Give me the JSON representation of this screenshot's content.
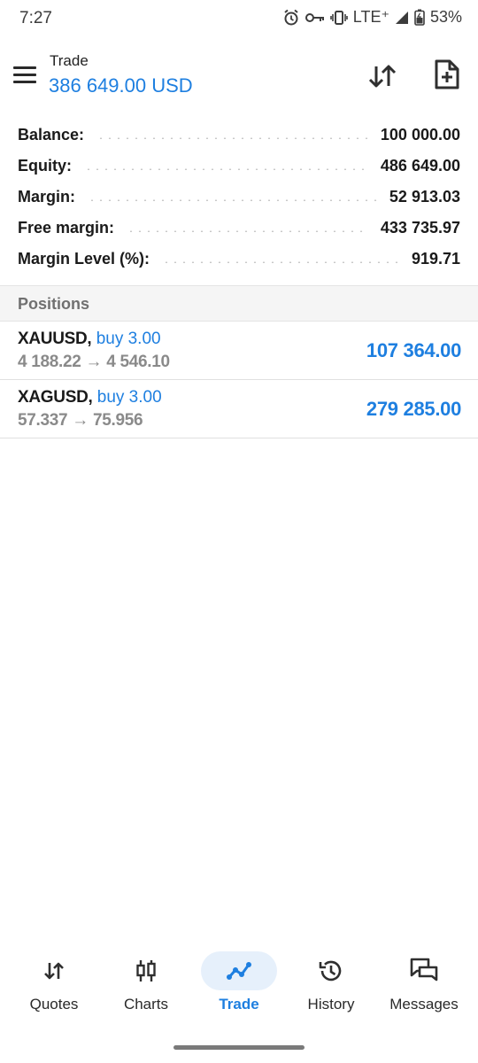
{
  "status_bar": {
    "time": "7:27",
    "network": "LTE⁺",
    "battery": "53%",
    "icons": [
      "alarm-icon",
      "key-icon",
      "vibrate-icon",
      "signal-icon",
      "battery-icon"
    ]
  },
  "header": {
    "title": "Trade",
    "balance": "386 649.00 USD",
    "icons": [
      "menu-icon",
      "sort-arrows-icon",
      "new-order-icon"
    ]
  },
  "summary": [
    {
      "label": "Balance:",
      "value": "100 000.00"
    },
    {
      "label": "Equity:",
      "value": "486 649.00"
    },
    {
      "label": "Margin:",
      "value": "52 913.03"
    },
    {
      "label": "Free margin:",
      "value": "433 735.97"
    },
    {
      "label": "Margin Level (%):",
      "value": "919.71"
    }
  ],
  "positions": {
    "title": "Positions",
    "items": [
      {
        "symbol": "XAUUSD,",
        "type": "buy 3.00",
        "prices": "4 188.22 → 4 546.10",
        "profit": "107 364.00"
      },
      {
        "symbol": "XAGUSD,",
        "type": "buy 3.00",
        "prices": "57.337 → 75.956",
        "profit": "279 285.00"
      }
    ]
  },
  "bottom_nav": [
    {
      "label": "Quotes",
      "icon": "quotes-icon",
      "active": false
    },
    {
      "label": "Charts",
      "icon": "charts-icon",
      "active": false
    },
    {
      "label": "Trade",
      "icon": "trade-icon",
      "active": true
    },
    {
      "label": "History",
      "icon": "history-icon",
      "active": false
    },
    {
      "label": "Messages",
      "icon": "messages-icon",
      "active": false
    }
  ],
  "colors": {
    "accent": "#1e7fe0",
    "active_nav_bg": "#e6f0fb",
    "text": "#1a1a1a",
    "muted": "#8a8a8a"
  }
}
